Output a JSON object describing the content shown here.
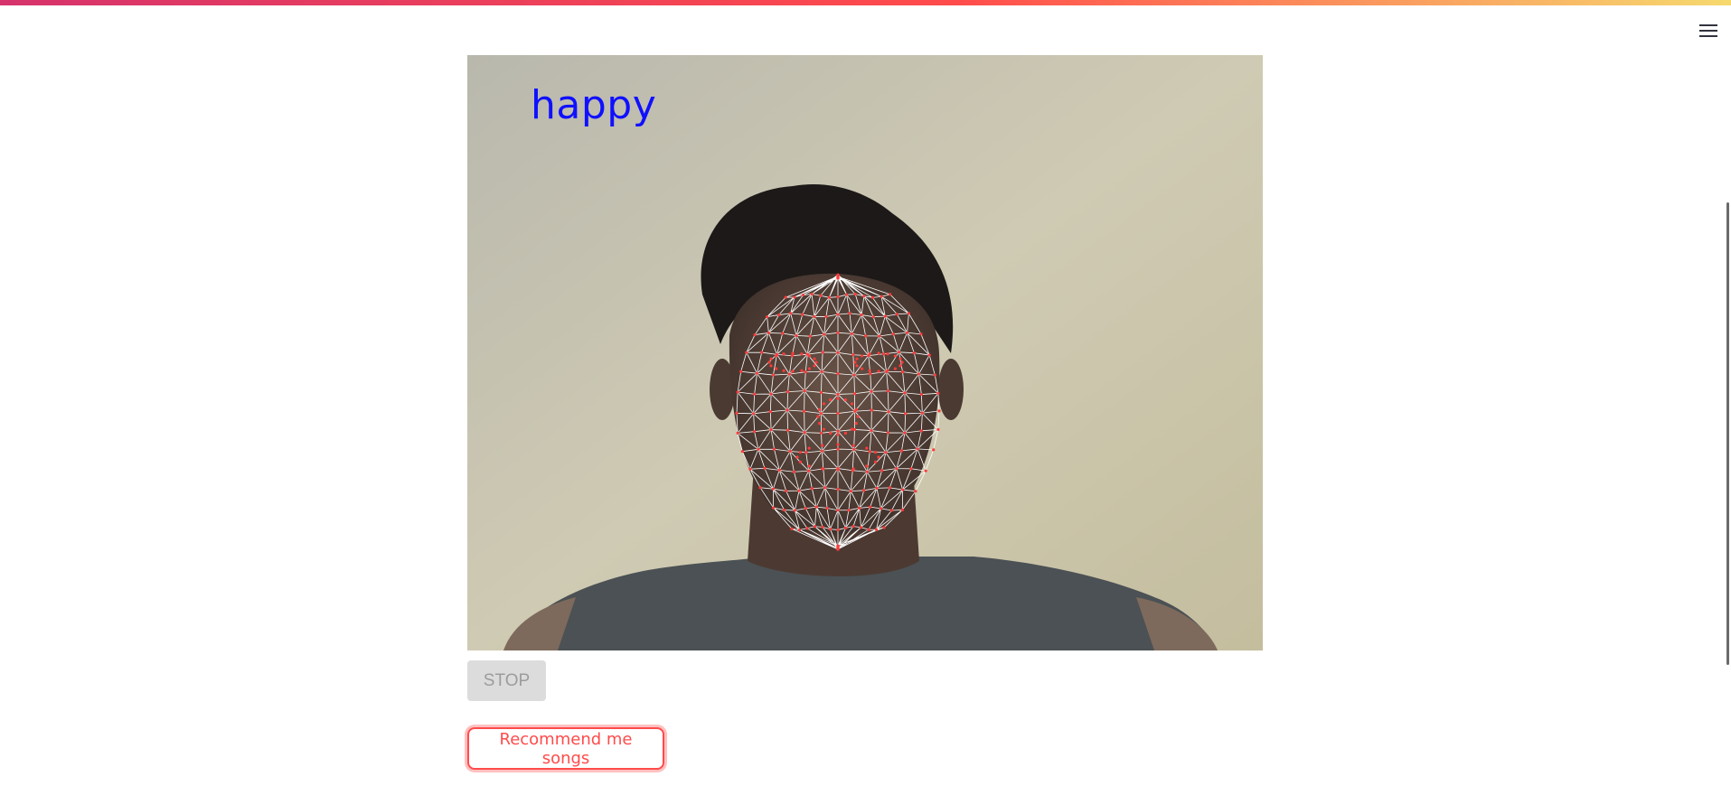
{
  "app": {
    "accent_color": "#ff4b4b",
    "menu_icon": "hamburger-menu-icon"
  },
  "webcam": {
    "emotion_label": "happy",
    "emotion_label_color": "#1010ff",
    "mesh_color": "#ff3b3b"
  },
  "controls": {
    "stop_label": "STOP",
    "recommend_label": "Recommend me songs"
  }
}
